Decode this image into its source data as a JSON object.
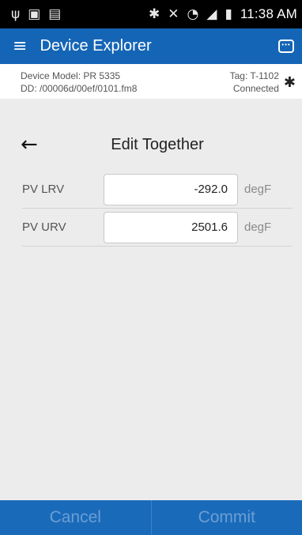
{
  "status_bar": {
    "usb_icon": "ψ",
    "image_icon": "▣",
    "sd_icon": "▤",
    "bluetooth_icon": "✱",
    "mute_icon": "✕",
    "wifi_icon": "◔",
    "signal_icon": "◢",
    "battery_icon": "▮",
    "time": "11:38 AM"
  },
  "app_bar": {
    "menu_icon": "≡",
    "title": "Device Explorer",
    "chat_icon": "•••"
  },
  "device_info": {
    "model": "Device Model:  PR 5335",
    "dd": "DD:  /00006d/00ef/0101.fm8",
    "tag": "Tag:  T-1102",
    "status": "Connected",
    "bluetooth_icon": "✱"
  },
  "page": {
    "back_icon": "←",
    "title": "Edit Together"
  },
  "fields": [
    {
      "label": "PV LRV",
      "value": "-292.0",
      "unit": "degF"
    },
    {
      "label": "PV URV",
      "value": "2501.6",
      "unit": "degF"
    }
  ],
  "actions": {
    "cancel": "Cancel",
    "commit": "Commit"
  },
  "colors": {
    "app_bar": "#1565b6",
    "bottom_bar": "#1a6aba",
    "button_text_disabled": "#6b9fd3",
    "background": "#ececec"
  }
}
